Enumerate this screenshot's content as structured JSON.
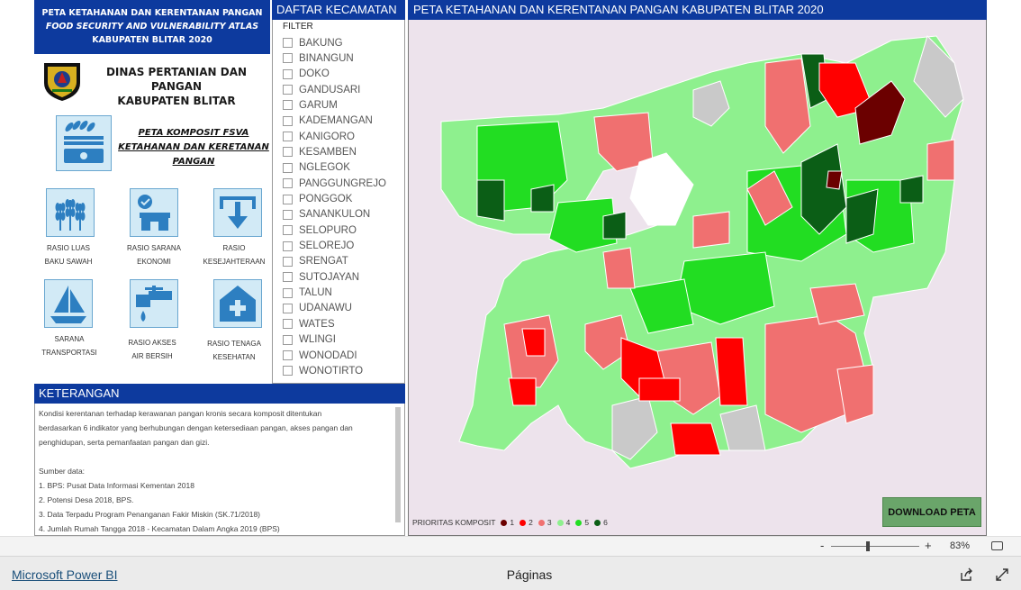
{
  "header": {
    "line1": "PETA KETAHANAN DAN KERENTANAN PANGAN",
    "line2": "FOOD SECURITY AND VULNERABILITY ATLAS",
    "line3": "KABUPATEN BLITAR 2020"
  },
  "org": {
    "line1": "DINAS PERTANIAN DAN PANGAN",
    "line2": "KABUPATEN BLITAR"
  },
  "komposit_link": "PETA KOMPOSIT FSVA KETAHANAN DAN KERETANAN PANGAN",
  "indicators": [
    {
      "label1": "RASIO LUAS",
      "label2": "BAKU SAWAH",
      "icon": "wheat-icon"
    },
    {
      "label1": "RASIO SARANA",
      "label2": "EKONOMI",
      "icon": "store-icon"
    },
    {
      "label1": "RASIO",
      "label2": "KESEJAHTERAAN",
      "icon": "download-tray-icon"
    },
    {
      "label1": "SARANA",
      "label2": "TRANSPORTASI",
      "icon": "sailboat-icon"
    },
    {
      "label1": "RASIO AKSES",
      "label2": "AIR BERSIH",
      "icon": "faucet-icon"
    },
    {
      "label1": "RASIO TENAGA",
      "label2": "KESEHATAN",
      "icon": "health-house-icon"
    }
  ],
  "filter_panel": {
    "title": "DAFTAR KECAMATAN",
    "filter_label": "FILTER",
    "items": [
      "BAKUNG",
      "BINANGUN",
      "DOKO",
      "GANDUSARI",
      "GARUM",
      "KADEMANGAN",
      "KANIGORO",
      "KESAMBEN",
      "NGLEGOK",
      "PANGGUNGREJO",
      "PONGGOK",
      "SANANKULON",
      "SELOPURO",
      "SELOREJO",
      "SRENGAT",
      "SUTOJAYAN",
      "TALUN",
      "UDANAWU",
      "WATES",
      "WLINGI",
      "WONODADI",
      "WONOTIRTO"
    ]
  },
  "map": {
    "title": "PETA KETAHANAN DAN KERENTANAN PANGAN KABUPATEN BLITAR 2020",
    "download_label": "DOWNLOAD PETA",
    "legend_title": "PRIORITAS KOMPOSIT",
    "legend": [
      {
        "label": "1",
        "color": "#6b0000"
      },
      {
        "label": "2",
        "color": "#ff0000"
      },
      {
        "label": "3",
        "color": "#f07070"
      },
      {
        "label": "4",
        "color": "#8ef08e"
      },
      {
        "label": "5",
        "color": "#22dd22"
      },
      {
        "label": "6",
        "color": "#0b5e16"
      }
    ]
  },
  "keterangan": {
    "title": "KETERANGAN",
    "lines": [
      "Kondisi kerentanan terhadap kerawanan pangan kronis secara komposit ditentukan",
      "berdasarkan 6 indikator yang berhubungan dengan ketersediaan pangan, akses pangan dan",
      "penghidupan, serta pemanfaatan pangan dan gizi.",
      "",
      "Sumber data:",
      "1. BPS: Pusat Data Informasi Kementan 2018",
      "2. Potensi Desa 2018, BPS.",
      "3. Data Terpadu Program Penanganan Fakir Miskin  (SK.71/2018)",
      "4. Jumlah Rumah Tangga 2018 - Kecamatan Dalam Angka 2019 (BPS)"
    ]
  },
  "zoom": {
    "minus": "-",
    "plus": "+",
    "percent": "83%",
    "level": 0.42
  },
  "footer": {
    "powerbi_link": "Microsoft Power BI",
    "pages_label": "Páginas"
  }
}
